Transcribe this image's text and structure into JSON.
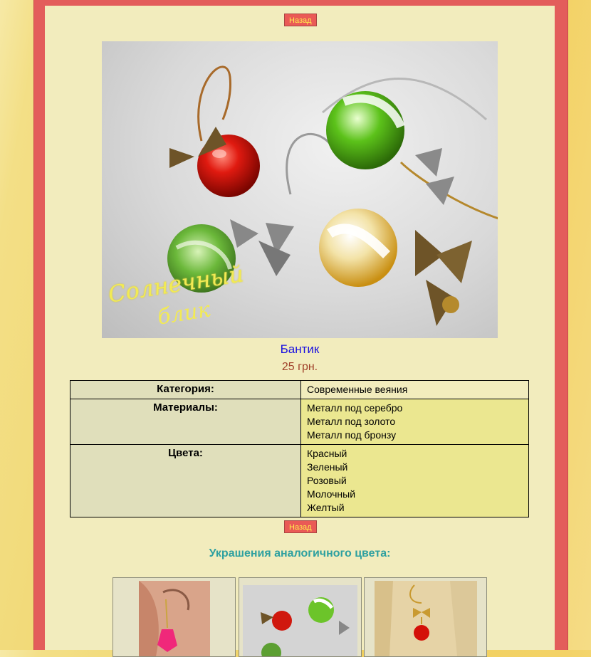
{
  "nav": {
    "back_label": "Назад"
  },
  "product": {
    "photo_watermark_line1": "Солнечный",
    "photo_watermark_line2": "блик",
    "title": "Бантик",
    "price": "25 грн."
  },
  "specs": {
    "category_label": "Категория:",
    "category_value": "Современные веяния",
    "materials_label": "Материалы:",
    "materials": [
      "Металл под серебро",
      "Металл под золото",
      "Металл под бронзу"
    ],
    "colors_label": "Цвета:",
    "colors": [
      "Красный",
      "Зеленый",
      "Розовый",
      "Молочный",
      "Желтый"
    ]
  },
  "related": {
    "heading": "Украшения аналогичного цвета:"
  },
  "theme": {
    "frame_color": "#e35d5b",
    "content_bg": "#f2ecbd",
    "title_color": "#1a10e0",
    "price_color": "#a0402a",
    "heading_color": "#2ea0a0"
  }
}
